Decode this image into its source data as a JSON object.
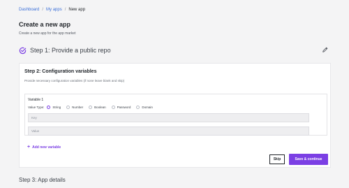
{
  "breadcrumb": {
    "items": [
      "Dashboard",
      "My apps"
    ],
    "current": "New app",
    "separator": "/"
  },
  "page": {
    "title": "Create a new app",
    "subtitle": "Create a new app for the app market"
  },
  "step1": {
    "label": "Step 1: Provide a public repo",
    "check_icon": "check-circle-icon",
    "edit_icon": "pencil-icon"
  },
  "step2": {
    "title": "Step 2: Configuration variables",
    "description": "Provide necessary configuration variables (if none leave blank and skip)",
    "variable": {
      "title": "Variable 1",
      "type_label": "Value Type:",
      "types": [
        "String",
        "Number",
        "Boolean",
        "Password",
        "Domain"
      ],
      "selected_type": "String",
      "key_placeholder": "Key",
      "value_placeholder": "Value"
    },
    "add_variable": "Add new variable",
    "skip_button": "Skip",
    "save_button": "Save & continue"
  },
  "step3": {
    "label": "Step 3: App details"
  },
  "colors": {
    "accent": "#7b3fe4",
    "link": "#3b6fd8",
    "background": "#f4f4f5"
  }
}
